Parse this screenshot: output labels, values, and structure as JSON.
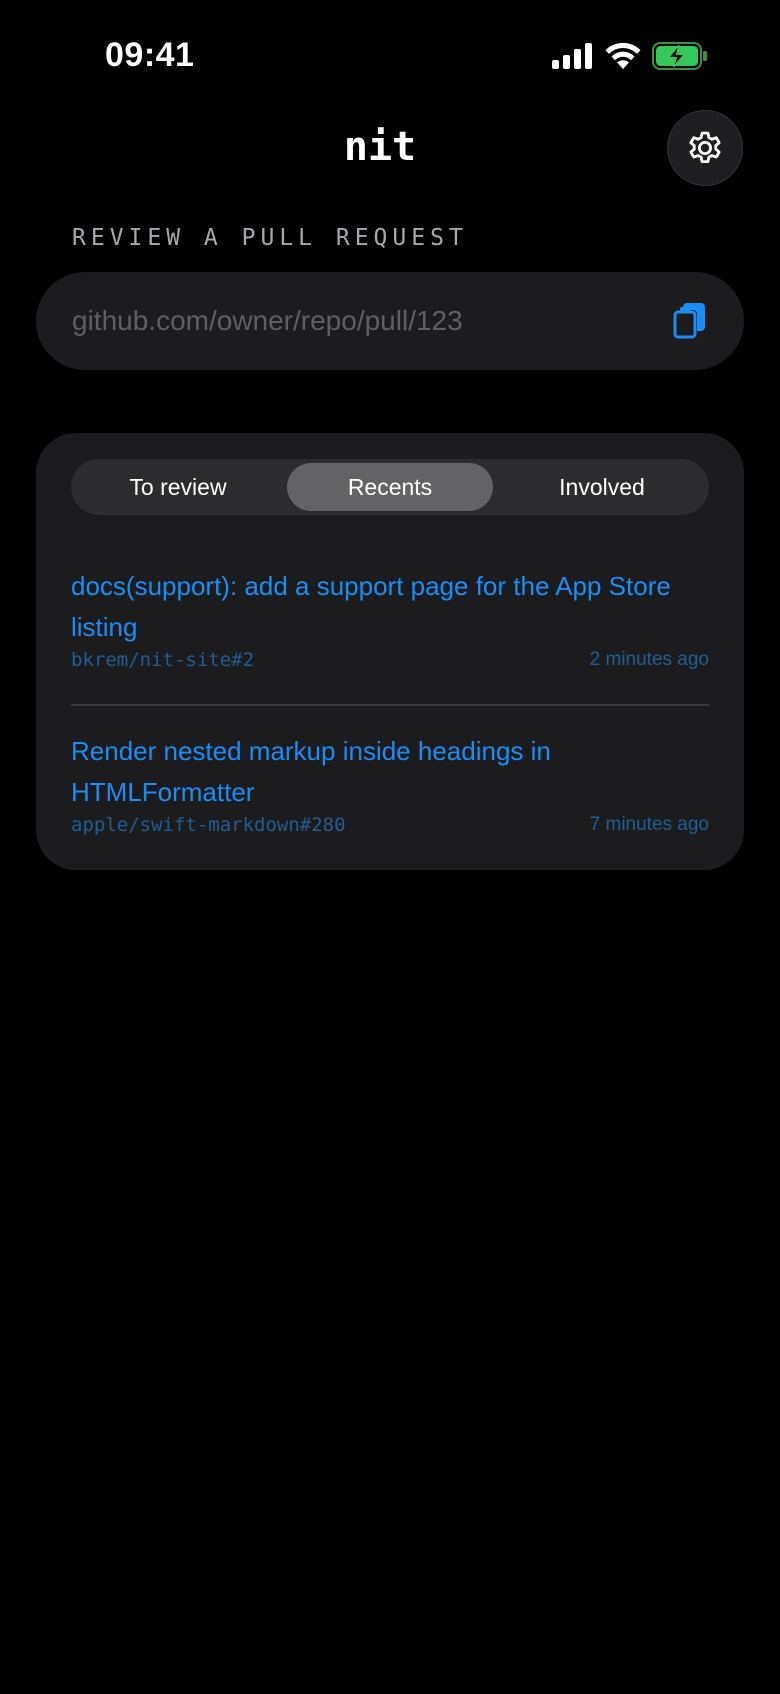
{
  "status_bar": {
    "time": "09:41",
    "icons": [
      "cellular-signal-icon",
      "wifi-icon",
      "battery-charging-icon"
    ]
  },
  "header": {
    "title": "nit",
    "settings_icon": "gear-icon"
  },
  "review": {
    "section_label": "REVIEW A PULL REQUEST",
    "url_placeholder": "github.com/owner/repo/pull/123",
    "url_value": "",
    "paste_icon": "clipboard-paste-icon"
  },
  "tabs": {
    "items": [
      {
        "label": "To review"
      },
      {
        "label": "Recents"
      },
      {
        "label": "Involved"
      }
    ],
    "selected": "Recents"
  },
  "pull_requests": [
    {
      "title": "docs(support): add a support page for the App Store listing",
      "repo": "bkrem/nit-site#2",
      "time": "2 minutes ago"
    },
    {
      "title": "Render nested markup inside headings in HTMLFormatter",
      "repo": "apple/swift-markdown#280",
      "time": "7 minutes ago"
    }
  ],
  "colors": {
    "background": "#000000",
    "card": "#1c1c1e",
    "accent": "#1a8ef5",
    "muted_accent": "#1f5d93",
    "battery": "#34c759"
  }
}
